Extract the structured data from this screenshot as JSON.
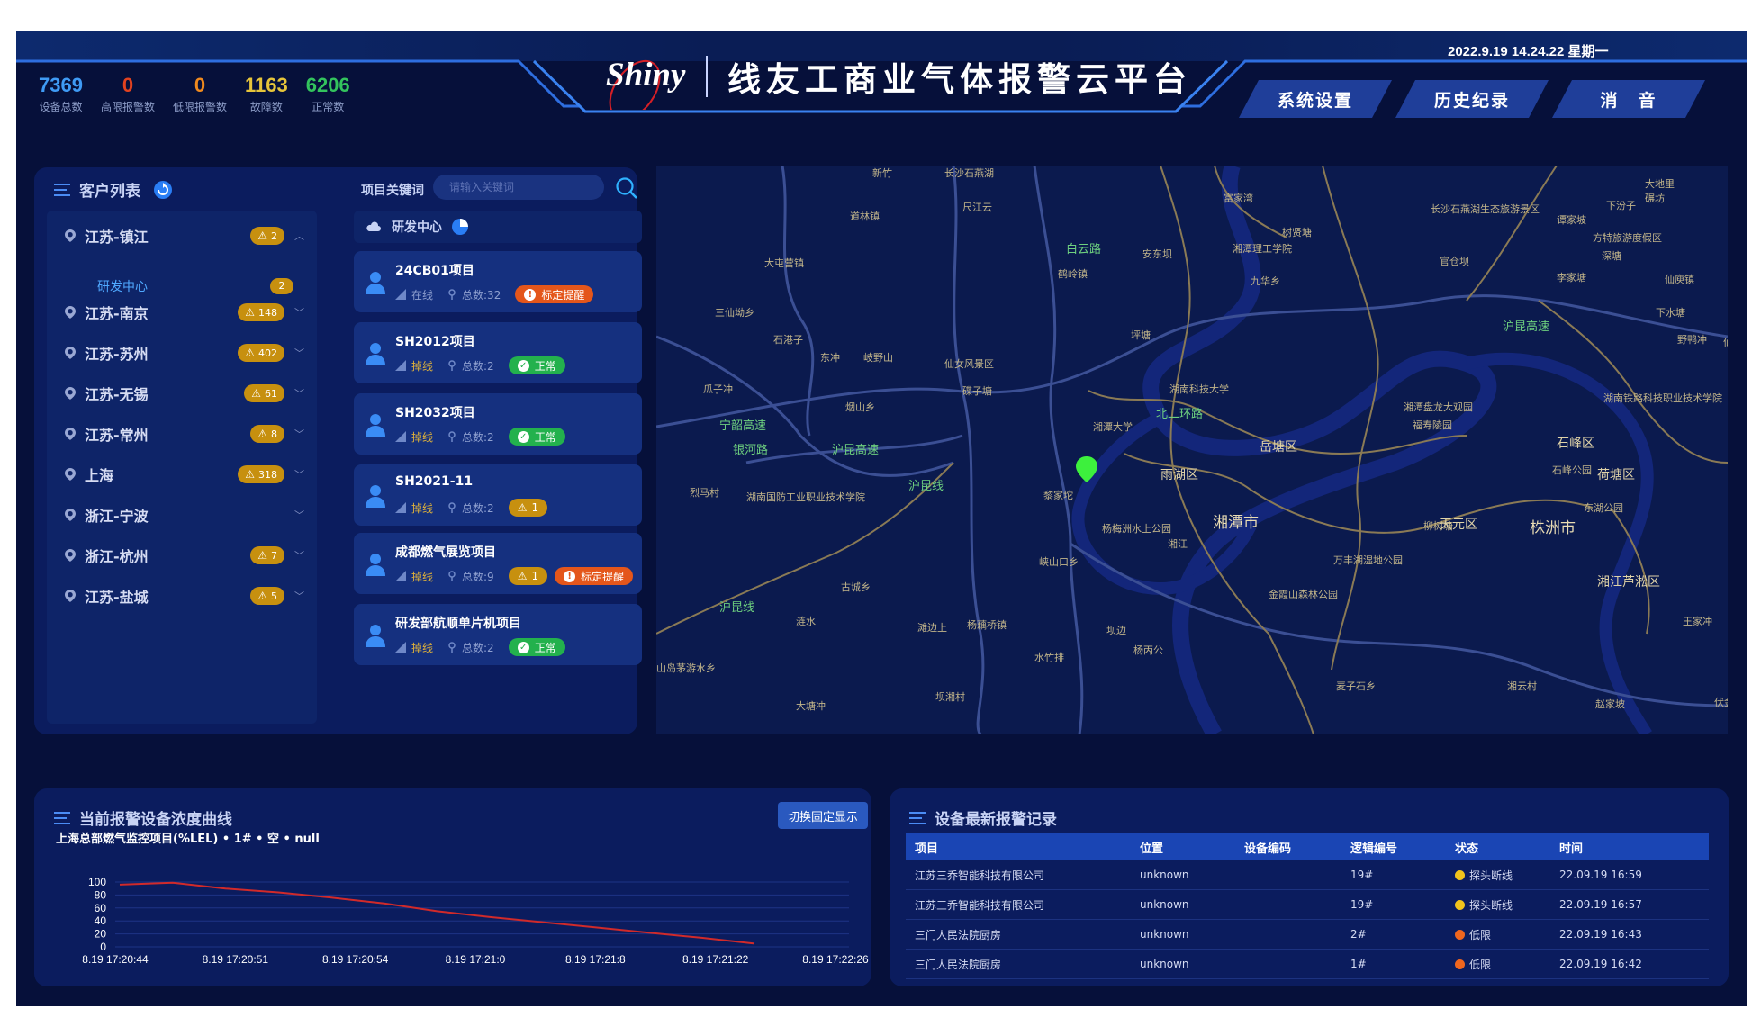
{
  "header": {
    "datetime": "2022.9.19 14.24.22 星期一",
    "logo_text": "Shiny",
    "title": "线友工商业气体报警云平台",
    "nav": [
      {
        "label": "系统设置"
      },
      {
        "label": "历史纪录"
      },
      {
        "label": "消　音"
      }
    ],
    "stats": [
      {
        "value": "7369",
        "label": "设备总数",
        "color": "#3f9bf5"
      },
      {
        "value": "0",
        "label": "高限报警数",
        "color": "#e2421f"
      },
      {
        "value": "0",
        "label": "低限报警数",
        "color": "#f08a1e"
      },
      {
        "value": "1163",
        "label": "故障数",
        "color": "#e6c43a"
      },
      {
        "value": "6206",
        "label": "正常数",
        "color": "#33c35d"
      }
    ]
  },
  "customers": {
    "title": "客户列表",
    "keyword_label": "项目关键词",
    "keyword_placeholder": "请输入关键词",
    "regions": [
      {
        "name": "江苏-镇江",
        "count": "2"
      },
      {
        "name": "江苏-南京",
        "count": "148"
      },
      {
        "name": "江苏-苏州",
        "count": "402"
      },
      {
        "name": "江苏-无锡",
        "count": "61"
      },
      {
        "name": "江苏-常州",
        "count": "8"
      },
      {
        "name": "上海",
        "count": "318"
      },
      {
        "name": "浙江-宁波",
        "count": ""
      },
      {
        "name": "浙江-杭州",
        "count": "7"
      },
      {
        "name": "江苏-盐城",
        "count": "5"
      }
    ],
    "sub_item": {
      "name": "研发中心",
      "count": "2"
    },
    "department": "研发中心",
    "projects": [
      {
        "name": "24CB01项目",
        "status": "在线",
        "total": "总数:32",
        "tags": [
          {
            "type": "orange",
            "text": "标定提醒"
          }
        ]
      },
      {
        "name": "SH2012项目",
        "status": "掉线",
        "total": "总数:2",
        "tags": [
          {
            "type": "green",
            "text": "正常"
          }
        ]
      },
      {
        "name": "SH2032项目",
        "status": "掉线",
        "total": "总数:2",
        "tags": [
          {
            "type": "green",
            "text": "正常"
          }
        ]
      },
      {
        "name": "SH2021-11",
        "status": "掉线",
        "total": "总数:2",
        "tags": [
          {
            "type": "amber",
            "text": "1"
          }
        ]
      },
      {
        "name": "成都燃气展览项目",
        "status": "掉线",
        "total": "总数:9",
        "tags": [
          {
            "type": "amber",
            "text": "1"
          },
          {
            "type": "orange",
            "text": "标定提醒"
          }
        ]
      },
      {
        "name": "研发部航顺单片机项目",
        "status": "掉线",
        "total": "总数:2",
        "tags": [
          {
            "type": "green",
            "text": "正常"
          }
        ]
      }
    ]
  },
  "map": {
    "labels": [
      {
        "t": "新竹",
        "k": ""
      },
      {
        "t": "长沙石燕湖",
        "k": ""
      },
      {
        "t": "大地里",
        "k": ""
      },
      {
        "t": "碾坊",
        "k": ""
      },
      {
        "t": "道林镇",
        "k": ""
      },
      {
        "t": "尺江云",
        "k": ""
      },
      {
        "t": "富家湾",
        "k": ""
      },
      {
        "t": "下汾子",
        "k": ""
      },
      {
        "t": "长沙石燕湖生态旅游景区",
        "k": ""
      },
      {
        "t": "谭家坡",
        "k": ""
      },
      {
        "t": "方特旅游度假区",
        "k": ""
      },
      {
        "t": "大屯营镇",
        "k": ""
      },
      {
        "t": "白云路",
        "k": "g"
      },
      {
        "t": "树贤塘",
        "k": ""
      },
      {
        "t": "安东坝",
        "k": ""
      },
      {
        "t": "湘潭理工学院",
        "k": ""
      },
      {
        "t": "深塘",
        "k": ""
      },
      {
        "t": "官仓坝",
        "k": ""
      },
      {
        "t": "李家塘",
        "k": ""
      },
      {
        "t": "仙庾镇",
        "k": ""
      },
      {
        "t": "鹤岭镇",
        "k": ""
      },
      {
        "t": "九华乡",
        "k": ""
      },
      {
        "t": "三仙坳乡",
        "k": ""
      },
      {
        "t": "宁韶高速",
        "k": "g"
      },
      {
        "t": "石港子",
        "k": ""
      },
      {
        "t": "下水塘",
        "k": ""
      },
      {
        "t": "沪昆高速",
        "k": "g"
      },
      {
        "t": "坪塘",
        "k": ""
      },
      {
        "t": "东冲",
        "k": ""
      },
      {
        "t": "岐野山",
        "k": ""
      },
      {
        "t": "仙女风景区",
        "k": ""
      },
      {
        "t": "野鸭冲",
        "k": ""
      },
      {
        "t": "仙庾",
        "k": ""
      },
      {
        "t": "瓜子冲",
        "k": ""
      },
      {
        "t": "碟子塘",
        "k": ""
      },
      {
        "t": "湖南科技大学",
        "k": ""
      },
      {
        "t": "湖南铁路科技职业技术学院",
        "k": ""
      },
      {
        "t": "烟山乡",
        "k": ""
      },
      {
        "t": "湘潭大学",
        "k": ""
      },
      {
        "t": "北二环路",
        "k": "g"
      },
      {
        "t": "湘潭盘龙大观园",
        "k": ""
      },
      {
        "t": "福寿陵园",
        "k": ""
      },
      {
        "t": "石峰区",
        "k": "mid"
      },
      {
        "t": "银河路",
        "k": "g"
      },
      {
        "t": "沪昆高速",
        "k": "g"
      },
      {
        "t": "岳塘区",
        "k": "mid"
      },
      {
        "t": "雨湖区",
        "k": "mid"
      },
      {
        "t": "石峰公园",
        "k": ""
      },
      {
        "t": "荷塘区",
        "k": "mid"
      },
      {
        "t": "烈马村",
        "k": ""
      },
      {
        "t": "湖南国防工业职业技术学院",
        "k": ""
      },
      {
        "t": "沪昆线",
        "k": "g"
      },
      {
        "t": "黎家坨",
        "k": ""
      },
      {
        "t": "湘潭市",
        "k": "big"
      },
      {
        "t": "杨梅洲水上公园",
        "k": ""
      },
      {
        "t": "柳树塘",
        "k": ""
      },
      {
        "t": "天元区",
        "k": "mid"
      },
      {
        "t": "株洲市",
        "k": "big"
      },
      {
        "t": "东湖公园",
        "k": ""
      },
      {
        "t": "峡山口乡",
        "k": ""
      },
      {
        "t": "湘江",
        "k": ""
      },
      {
        "t": "万丰湖湿地公园",
        "k": ""
      },
      {
        "t": "湘江芦淞区",
        "k": "mid"
      },
      {
        "t": "古城乡",
        "k": ""
      },
      {
        "t": "金霞山森林公园",
        "k": ""
      },
      {
        "t": "沪昆线",
        "k": "g"
      },
      {
        "t": "涟水",
        "k": ""
      },
      {
        "t": "滩边上",
        "k": ""
      },
      {
        "t": "杨藕桥镇",
        "k": ""
      },
      {
        "t": "坝边",
        "k": ""
      },
      {
        "t": "水竹排",
        "k": ""
      },
      {
        "t": "杨丙公",
        "k": ""
      },
      {
        "t": "王家冲",
        "k": ""
      },
      {
        "t": "山岛茅游水乡",
        "k": ""
      },
      {
        "t": "麦子石乡",
        "k": ""
      },
      {
        "t": "湘云村",
        "k": ""
      },
      {
        "t": "大塘冲",
        "k": ""
      },
      {
        "t": "坝湘村",
        "k": ""
      },
      {
        "t": "赵家坡",
        "k": ""
      },
      {
        "t": "伏金",
        "k": ""
      }
    ]
  },
  "chart": {
    "title": "当前报警设备浓度曲线",
    "switch_label": "切换固定显示",
    "subtitle": "上海总部燃气监控项目(%LEL) • 1# • 空 • null"
  },
  "chart_data": {
    "type": "line",
    "x": [
      "8.19 17:20:44",
      "",
      "8.19 17:20:51",
      "",
      "8.19 17:20:54",
      "",
      "8.19 17:21:0",
      "",
      "8.19 17:21:8",
      "",
      "8.19 17:21:22",
      "",
      "8.19 17:22:26"
    ],
    "series": [
      {
        "values": [
          96,
          99,
          90,
          84,
          76,
          67,
          55,
          46,
          38,
          30,
          22,
          14,
          5
        ]
      }
    ],
    "ylim": [
      0,
      100
    ],
    "yticks": [
      0,
      20,
      40,
      60,
      80,
      100
    ],
    "xticks": [
      "8.19 17:20:44",
      "8.19 17:20:51",
      "8.19 17:20:54",
      "8.19 17:21:0",
      "8.19 17:21:8",
      "8.19 17:21:22",
      "8.19 17:22:26"
    ],
    "line_color": "#d12a2a",
    "grid": true
  },
  "alarms": {
    "title": "设备最新报警记录",
    "columns": [
      "项目",
      "位置",
      "设备编码",
      "逻辑编号",
      "状态",
      "时间"
    ],
    "rows": [
      {
        "project": "江苏三乔智能科技有限公司",
        "location": "unknown",
        "code": "",
        "logic": "19#",
        "status": "探头断线",
        "status_color": "#f1c31c",
        "time": "22.09.19 16:59"
      },
      {
        "project": "江苏三乔智能科技有限公司",
        "location": "unknown",
        "code": "",
        "logic": "19#",
        "status": "探头断线",
        "status_color": "#f1c31c",
        "time": "22.09.19 16:57"
      },
      {
        "project": "三门人民法院厨房",
        "location": "unknown",
        "code": "",
        "logic": "2#",
        "status": "低限",
        "status_color": "#f0661e",
        "time": "22.09.19 16:43"
      },
      {
        "project": "三门人民法院厨房",
        "location": "unknown",
        "code": "",
        "logic": "1#",
        "status": "低限",
        "status_color": "#f0661e",
        "time": "22.09.19 16:42"
      }
    ]
  }
}
